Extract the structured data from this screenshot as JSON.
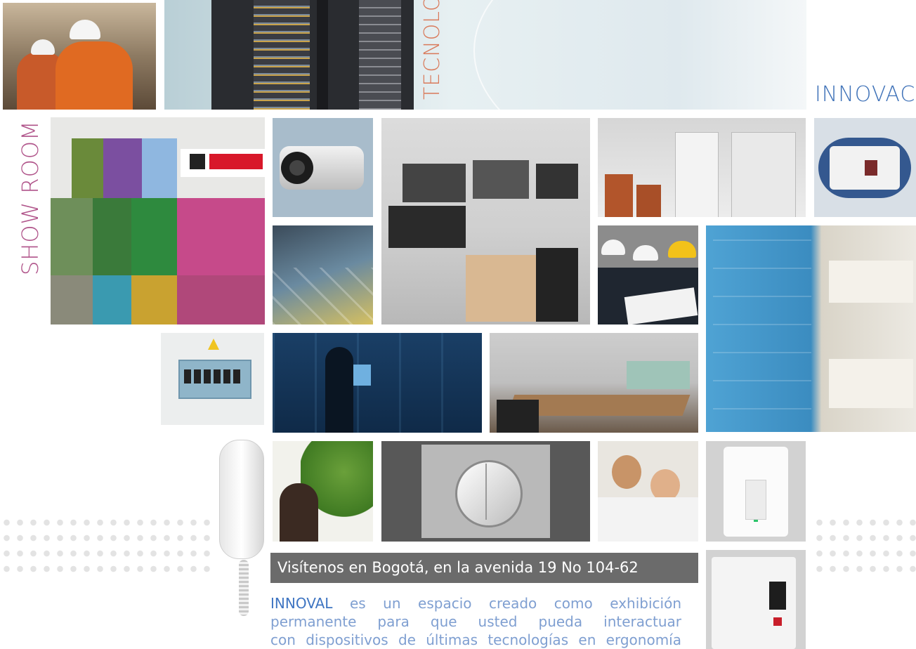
{
  "labels": {
    "tecnologia": "TECNOLOGÍA",
    "innovacion": "INNOVACIÓN",
    "showroom": "SHOW ROOM"
  },
  "colors": {
    "tecnologia": "#d97a5b",
    "innovacion": "#3f72b8",
    "showroom": "#b0548a",
    "caption_bg": "#6b6b6b",
    "body_text": "#7f9fd1"
  },
  "photos": [
    {
      "name": "construction-workers-photo",
      "description": "workers with hard hats"
    },
    {
      "name": "server-rack-photo",
      "description": "network server rack"
    },
    {
      "name": "legrand-wall-photo",
      "description": "showroom wall with logo"
    },
    {
      "name": "security-camera-photo",
      "description": "box camera"
    },
    {
      "name": "control-room-photo",
      "description": "monitoring room"
    },
    {
      "name": "electrical-panels-photo",
      "description": "electrical switchgear"
    },
    {
      "name": "wall-plate-photo",
      "description": "blue outlet plate"
    },
    {
      "name": "raised-floor-photo",
      "description": "data center raised floor"
    },
    {
      "name": "engineers-photo",
      "description": "engineers with blueprints"
    },
    {
      "name": "glass-display-photo",
      "description": "glass showroom display"
    },
    {
      "name": "breaker-panel-photo",
      "description": "breaker panel"
    },
    {
      "name": "touchscreen-photo",
      "description": "person at touchscreen"
    },
    {
      "name": "meeting-room-photo",
      "description": "conference room"
    },
    {
      "name": "intercom-phone-photo",
      "description": "intercom handset"
    },
    {
      "name": "plant-photo",
      "description": "woman with plant"
    },
    {
      "name": "round-switch-photo",
      "description": "round double switch"
    },
    {
      "name": "couple-photo",
      "description": "couple on sofa"
    },
    {
      "name": "light-switch-photo",
      "description": "white light switch"
    },
    {
      "name": "breaker-switch-photo",
      "description": "white breaker box"
    }
  ],
  "caption": "Visítenos en Bogotá, en la avenida 19 No 104-62",
  "intro": {
    "brand": "INNOVAL",
    "line1_rest": " es un espacio  creado como exhibición",
    "line2": "permanente para que usted pueda interactuar",
    "line3": "con dispositivos de últimas tecnologías en ergonomía"
  }
}
